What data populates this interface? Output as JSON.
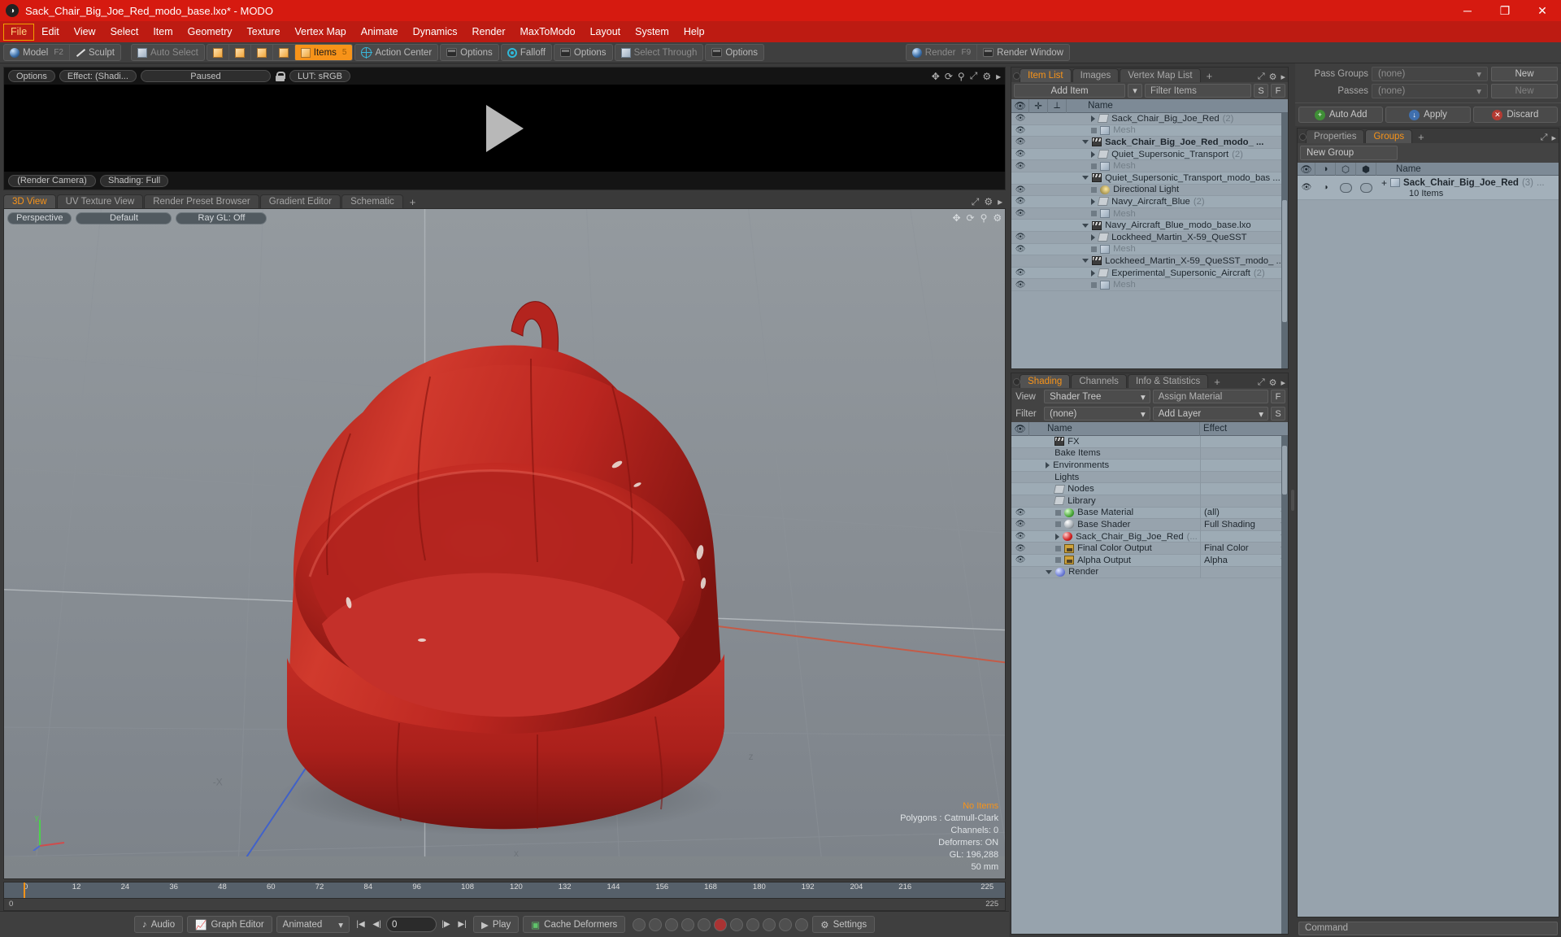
{
  "window": {
    "title": "Sack_Chair_Big_Joe_Red_modo_base.lxo* - MODO",
    "app_icon": "modo-logo-icon",
    "minimize": "─",
    "maximize": "❐",
    "close": "✕"
  },
  "menubar": {
    "items": [
      {
        "label": "File",
        "active": true
      },
      {
        "label": "Edit"
      },
      {
        "label": "View"
      },
      {
        "label": "Select"
      },
      {
        "label": "Item"
      },
      {
        "label": "Geometry"
      },
      {
        "label": "Texture"
      },
      {
        "label": "Vertex Map"
      },
      {
        "label": "Animate"
      },
      {
        "label": "Dynamics"
      },
      {
        "label": "Render"
      },
      {
        "label": "MaxToModo"
      },
      {
        "label": "Layout"
      },
      {
        "label": "System"
      },
      {
        "label": "Help"
      }
    ]
  },
  "modebar": {
    "model": "Model",
    "model_key": "F2",
    "sculpt": "Sculpt",
    "auto_select": "Auto Select",
    "items": "Items",
    "items_key": "5",
    "action_center": "Action Center",
    "options1": "Options",
    "falloff": "Falloff",
    "options2": "Options",
    "select_through": "Select Through",
    "options3": "Options",
    "render": "Render",
    "render_key": "F9",
    "render_window": "Render Window"
  },
  "render_preview": {
    "options": "Options",
    "effect": "Effect: (Shadi...",
    "paused": "Paused",
    "lock_icon": "lock-open-icon",
    "lut": "LUT: sRGB",
    "camera": "(Render Camera)",
    "shading": "Shading: Full",
    "play_icon": "play-triangle-icon"
  },
  "viewport": {
    "tabs": [
      {
        "label": "3D View",
        "selected": true
      },
      {
        "label": "UV Texture View"
      },
      {
        "label": "Render Preset Browser"
      },
      {
        "label": "Gradient Editor"
      },
      {
        "label": "Schematic"
      }
    ],
    "tab_plus": "+",
    "pills": [
      "Perspective",
      "Default",
      "Ray GL: Off"
    ],
    "stats": {
      "selection": "No Items",
      "polygons": "Polygons : Catmull-Clark",
      "channels": "Channels: 0",
      "deformers": "Deformers: ON",
      "gl": "GL: 196,288",
      "scale": "50 mm"
    },
    "axis_labels": {
      "x": "-X",
      "y": "y",
      "z": "z"
    }
  },
  "timeline": {
    "ticks": [
      "0",
      "12",
      "24",
      "36",
      "48",
      "60",
      "72",
      "84",
      "96",
      "108",
      "120",
      "132",
      "144",
      "156",
      "168",
      "180",
      "192",
      "204",
      "216"
    ],
    "range_start": "0",
    "range_end": "225",
    "center_label": "225",
    "bar_right": "225"
  },
  "bottombar": {
    "audio": "Audio",
    "graph_editor": "Graph Editor",
    "animated": "Animated",
    "frame_value": "0",
    "play": "Play",
    "cache_deformers": "Cache Deformers",
    "settings": "Settings"
  },
  "item_list": {
    "tabs": [
      {
        "label": "Item List",
        "selected": true
      },
      {
        "label": "Images"
      },
      {
        "label": "Vertex Map List"
      }
    ],
    "tab_plus": "+",
    "add_item": "Add Item",
    "filter_placeholder": "Filter Items",
    "btn_s": "S",
    "btn_f": "F",
    "col_name": "Name",
    "rows": [
      {
        "label": "Mesh",
        "icon": "mesh-icon",
        "indent": 2,
        "grey": true,
        "eye": true,
        "twirl": "dot"
      },
      {
        "label": "Experimental_Supersonic_Aircraft",
        "count": "(2)",
        "icon": "folder-icon",
        "indent": 2,
        "eye": true,
        "twirl": "right"
      },
      {
        "label": "Lockheed_Martin_X-59_QueSST_modo_ ...",
        "icon": "scene-icon",
        "indent": 1,
        "eye": false,
        "twirl": "down"
      },
      {
        "label": "Mesh",
        "icon": "mesh-icon",
        "indent": 2,
        "grey": true,
        "eye": true,
        "twirl": "dot"
      },
      {
        "label": "Lockheed_Martin_X-59_QueSST",
        "icon": "folder-icon",
        "indent": 2,
        "eye": true,
        "twirl": "right"
      },
      {
        "label": "Navy_Aircraft_Blue_modo_base.lxo",
        "icon": "scene-icon",
        "indent": 1,
        "eye": false,
        "twirl": "down"
      },
      {
        "label": "Mesh",
        "icon": "mesh-icon",
        "indent": 2,
        "grey": true,
        "eye": true,
        "twirl": "dot"
      },
      {
        "label": "Navy_Aircraft_Blue",
        "count": "(2)",
        "icon": "folder-icon",
        "indent": 2,
        "eye": true,
        "twirl": "right"
      },
      {
        "label": "Directional Light",
        "icon": "light-icon",
        "indent": 2,
        "eye": true,
        "twirl": "dot"
      },
      {
        "label": "Quiet_Supersonic_Transport_modo_bas ...",
        "icon": "scene-icon",
        "indent": 1,
        "eye": false,
        "twirl": "down"
      },
      {
        "label": "Mesh",
        "icon": "mesh-icon",
        "indent": 2,
        "grey": true,
        "eye": true,
        "twirl": "dot"
      },
      {
        "label": "Quiet_Supersonic_Transport",
        "count": "(2)",
        "icon": "folder-icon",
        "indent": 2,
        "eye": true,
        "twirl": "right"
      },
      {
        "label": "Sack_Chair_Big_Joe_Red_modo_  ...",
        "icon": "scene-icon",
        "indent": 1,
        "eye": true,
        "twirl": "down",
        "bold": true
      },
      {
        "label": "Mesh",
        "icon": "mesh-icon",
        "indent": 2,
        "grey": true,
        "eye": true,
        "twirl": "dot"
      },
      {
        "label": "Sack_Chair_Big_Joe_Red",
        "count": "(2)",
        "icon": "folder-icon",
        "indent": 2,
        "eye": true,
        "twirl": "right"
      }
    ]
  },
  "shading": {
    "tabs": [
      {
        "label": "Shading",
        "selected": true
      },
      {
        "label": "Channels"
      },
      {
        "label": "Info & Statistics"
      }
    ],
    "tab_plus": "+",
    "view_label": "View",
    "view_value": "Shader Tree",
    "assign_material": "Assign Material",
    "btn_f": "F",
    "filter_label": "Filter",
    "filter_value": "(none)",
    "add_layer": "Add Layer",
    "btn_s": "S",
    "col_name": "Name",
    "col_effect": "Effect",
    "rows": [
      {
        "label": "Render",
        "icon": "render-globe-icon",
        "indent": 1,
        "twirl": "down",
        "effect": "",
        "eye": false
      },
      {
        "label": "Alpha Output",
        "icon": "image-output-icon",
        "indent": 2,
        "twirl": "dot",
        "effect": "Alpha",
        "eye": true,
        "carat": true
      },
      {
        "label": "Final Color Output",
        "icon": "image-output-icon",
        "indent": 2,
        "twirl": "dot",
        "effect": "Final Color",
        "eye": true,
        "carat": true
      },
      {
        "label": "Sack_Chair_Big_Joe_Red",
        "count": "(...",
        "icon": "material-red-icon",
        "indent": 2,
        "twirl": "right",
        "effect": "",
        "eye": true,
        "carat": true
      },
      {
        "label": "Base Shader",
        "icon": "shader-icon",
        "indent": 2,
        "twirl": "dot",
        "effect": "Full Shading",
        "eye": true,
        "carat": true
      },
      {
        "label": "Base Material",
        "icon": "material-green-icon",
        "indent": 2,
        "twirl": "dot",
        "effect": "(all)",
        "eye": true,
        "carat": true
      },
      {
        "label": "Library",
        "icon": "folder-icon",
        "indent": 1,
        "twirl": "none",
        "effect": "",
        "eye": false
      },
      {
        "label": "Nodes",
        "icon": "folder-icon",
        "indent": 1,
        "twirl": "none",
        "effect": "",
        "eye": false
      },
      {
        "label": "Lights",
        "icon": "none",
        "indent": 1,
        "twirl": "none",
        "effect": "",
        "eye": false
      },
      {
        "label": "Environments",
        "icon": "none",
        "indent": 1,
        "twirl": "right",
        "effect": "",
        "eye": false
      },
      {
        "label": "Bake Items",
        "icon": "none",
        "indent": 1,
        "twirl": "none",
        "effect": "",
        "eye": false
      },
      {
        "label": "FX",
        "icon": "scene-icon",
        "indent": 1,
        "twirl": "none",
        "effect": "",
        "eye": false
      }
    ]
  },
  "passes": {
    "pass_groups_label": "Pass Groups",
    "pass_groups_value": "(none)",
    "pass_groups_new": "New",
    "passes_label": "Passes",
    "passes_value": "(none)",
    "passes_new": "New",
    "auto_add": "Auto Add",
    "apply": "Apply",
    "discard": "Discard"
  },
  "groups": {
    "tabs": [
      {
        "label": "Properties"
      },
      {
        "label": "Groups",
        "selected": true
      }
    ],
    "tab_plus": "+",
    "new_group": "New Group",
    "col_name": "Name",
    "row": {
      "label": "Sack_Chair_Big_Joe_Red",
      "count": "(3)",
      "ellipsis": "...",
      "sub": "10 Items",
      "plus": "+"
    }
  },
  "command": {
    "placeholder": "Command"
  },
  "colors": {
    "titlebar": "#d61a10",
    "menubar": "#bd1b12",
    "accent": "#f79319",
    "panel": "#434343",
    "tree": "#97a3ad",
    "chair_red": "#b9231f"
  }
}
